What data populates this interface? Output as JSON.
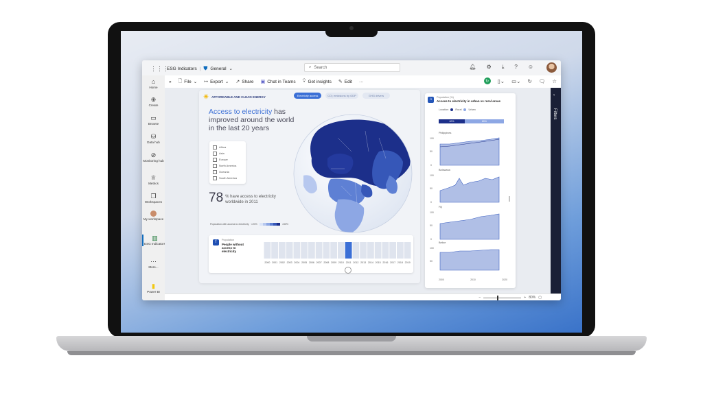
{
  "app": {
    "workspace": "ESG Indicators",
    "channel": "General",
    "search_placeholder": "Search"
  },
  "nav": {
    "items": [
      {
        "label": "Home",
        "icon": "home-icon"
      },
      {
        "label": "Create",
        "icon": "plus-icon"
      },
      {
        "label": "Browse",
        "icon": "folder-icon"
      },
      {
        "label": "Data hub",
        "icon": "database-icon"
      },
      {
        "label": "Monitoring hub",
        "icon": "monitor-icon"
      },
      {
        "label": "Metrics",
        "icon": "trophy-icon"
      },
      {
        "label": "Workspaces",
        "icon": "workspaces-icon"
      },
      {
        "label": "My workspace",
        "icon": "avatar-icon"
      },
      {
        "label": "ESG Indicators",
        "icon": "chart-icon"
      },
      {
        "label": "More...",
        "icon": "more-icon"
      },
      {
        "label": "Power BI",
        "icon": "powerbi-icon"
      }
    ]
  },
  "toolbar": {
    "file": "File",
    "export": "Export",
    "share": "Share",
    "chat": "Chat in Teams",
    "insights": "Get insights",
    "edit": "Edit",
    "more": "···"
  },
  "report": {
    "sdg_label": "AFFORDABLE AND CLEAN ENERGY",
    "pills": [
      "Electricity access",
      "CO₂ emissions by GDP",
      "GHG drivers"
    ],
    "headline_highlight": "Access to electricity",
    "headline_rest": " has improved around the world in the last 20 years",
    "regions": [
      "Africa",
      "Asia",
      "Europe",
      "North America",
      "Oceania",
      "South America"
    ],
    "stat_number": "78",
    "stat_text": "% have access to electricity worldwide in 2011",
    "legend_label": "Population with access to electricity",
    "legend_min": "<20%",
    "legend_max": ">80%",
    "bottom_sub": "Population",
    "bottom_title": "People without access to electricity",
    "years": [
      "2000",
      "2001",
      "2002",
      "2003",
      "2004",
      "2005",
      "2006",
      "2007",
      "2008",
      "2009",
      "2010",
      "2011",
      "2012",
      "2013",
      "2014",
      "2015",
      "2016",
      "2017",
      "2018",
      "2019"
    ],
    "selected_year": "2011"
  },
  "right_visual": {
    "subtitle": "Population (%)",
    "title": "Access to electricity in urban vs rural areas",
    "location_label": "Location",
    "rural": "Rural",
    "urban": "Urban",
    "bar_rural_label": "40%",
    "bar_urban_label": "60%",
    "bar_rural_fraction": 0.4,
    "countries": [
      "Philippines",
      "Botswana",
      "Fiji",
      "Belize"
    ],
    "x_ticks": [
      "2000",
      "2010",
      "2020"
    ],
    "y_ticks": [
      "100",
      "50",
      "0"
    ]
  },
  "statusbar": {
    "zoom": "80%"
  },
  "filters": {
    "label": "Filters"
  },
  "colors": {
    "accent": "#3b6fd6",
    "dark_navy": "#1a1f36",
    "powerbi_yellow": "#f2c811"
  }
}
